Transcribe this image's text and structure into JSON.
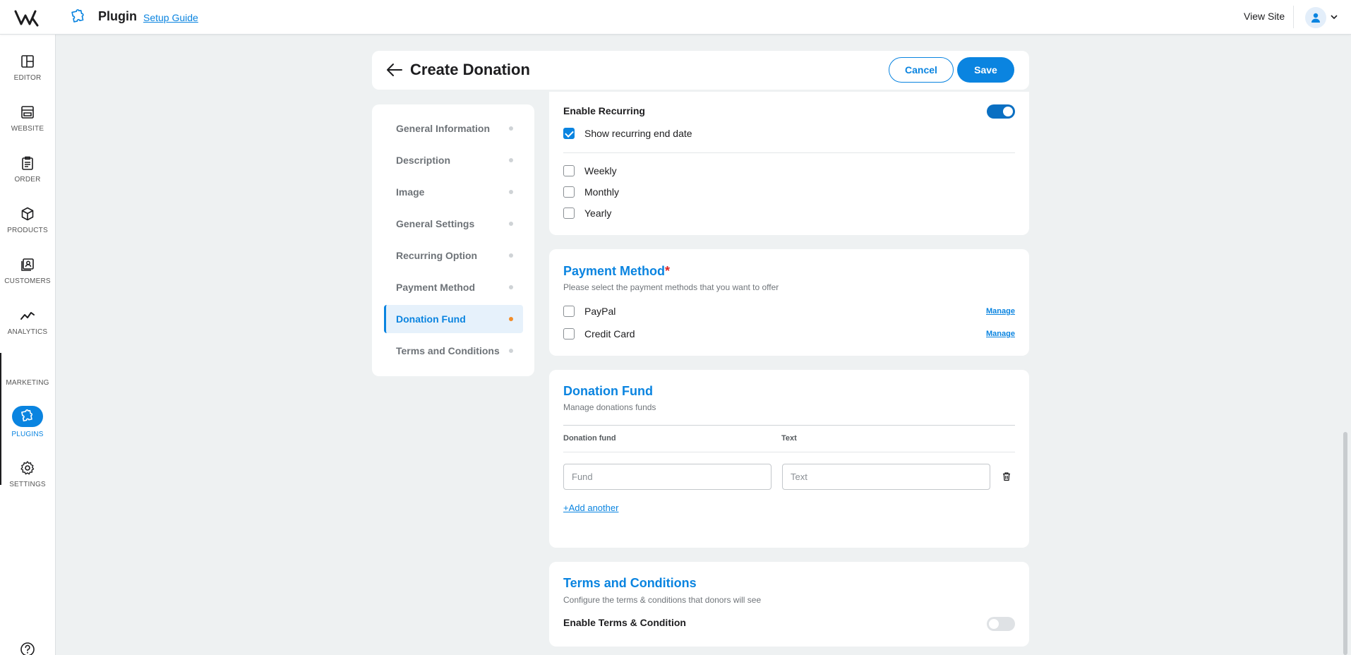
{
  "topbar": {
    "logo": "w-logo",
    "title": "Plugin",
    "setup_guide": "Setup Guide",
    "view_site": "View Site",
    "avatar_icon": "user-icon"
  },
  "sidebar": {
    "items": [
      {
        "label": "EDITOR",
        "icon": "layout-icon"
      },
      {
        "label": "WEBSITE",
        "icon": "browser-icon"
      },
      {
        "label": "ORDER",
        "icon": "clipboard-icon"
      },
      {
        "label": "PRODUCTS",
        "icon": "cube-icon"
      },
      {
        "label": "CUSTOMERS",
        "icon": "contacts-icon"
      },
      {
        "label": "ANALYTICS",
        "icon": "trend-icon"
      },
      {
        "label": "MARKETING",
        "icon": "megaphone-icon"
      },
      {
        "label": "PLUGINS",
        "icon": "puzzle-icon",
        "active": true
      },
      {
        "label": "SETTINGS",
        "icon": "gear-icon"
      }
    ],
    "help_icon": "question-icon"
  },
  "header": {
    "title": "Create Donation",
    "cancel_label": "Cancel",
    "save_label": "Save"
  },
  "steps": [
    {
      "label": "General Information"
    },
    {
      "label": "Description"
    },
    {
      "label": "Image"
    },
    {
      "label": "General Settings"
    },
    {
      "label": "Recurring Option"
    },
    {
      "label": "Payment Method"
    },
    {
      "label": "Donation Fund",
      "active": true
    },
    {
      "label": "Terms and Conditions"
    }
  ],
  "recurring": {
    "enable_label": "Enable Recurring",
    "enabled": true,
    "show_end_date_label": "Show recurring end date",
    "show_end_date_checked": true,
    "options": [
      {
        "label": "Weekly",
        "checked": false
      },
      {
        "label": "Monthly",
        "checked": false
      },
      {
        "label": "Yearly",
        "checked": false
      }
    ]
  },
  "payment": {
    "title": "Payment Method",
    "required_mark": "*",
    "subtitle": "Please select the payment methods that you want to offer",
    "methods": [
      {
        "label": "PayPal",
        "checked": false,
        "manage": "Manage"
      },
      {
        "label": "Credit Card",
        "checked": false,
        "manage": "Manage"
      }
    ]
  },
  "donation_fund": {
    "title": "Donation Fund",
    "subtitle": "Manage donations funds",
    "col_fund": "Donation fund",
    "col_text": "Text",
    "fund_placeholder": "Fund",
    "text_placeholder": "Text",
    "fund_value": "",
    "text_value": "",
    "add_another": "+Add another",
    "delete_icon": "trash-icon"
  },
  "terms": {
    "title": "Terms and Conditions",
    "subtitle": "Configure the terms & conditions that donors will see",
    "enable_label": "Enable Terms & Condition",
    "enabled": false
  },
  "colors": {
    "accent": "#0a84e0",
    "active_dot": "#f28c28",
    "required": "#e02424",
    "background": "#eef1f2"
  }
}
